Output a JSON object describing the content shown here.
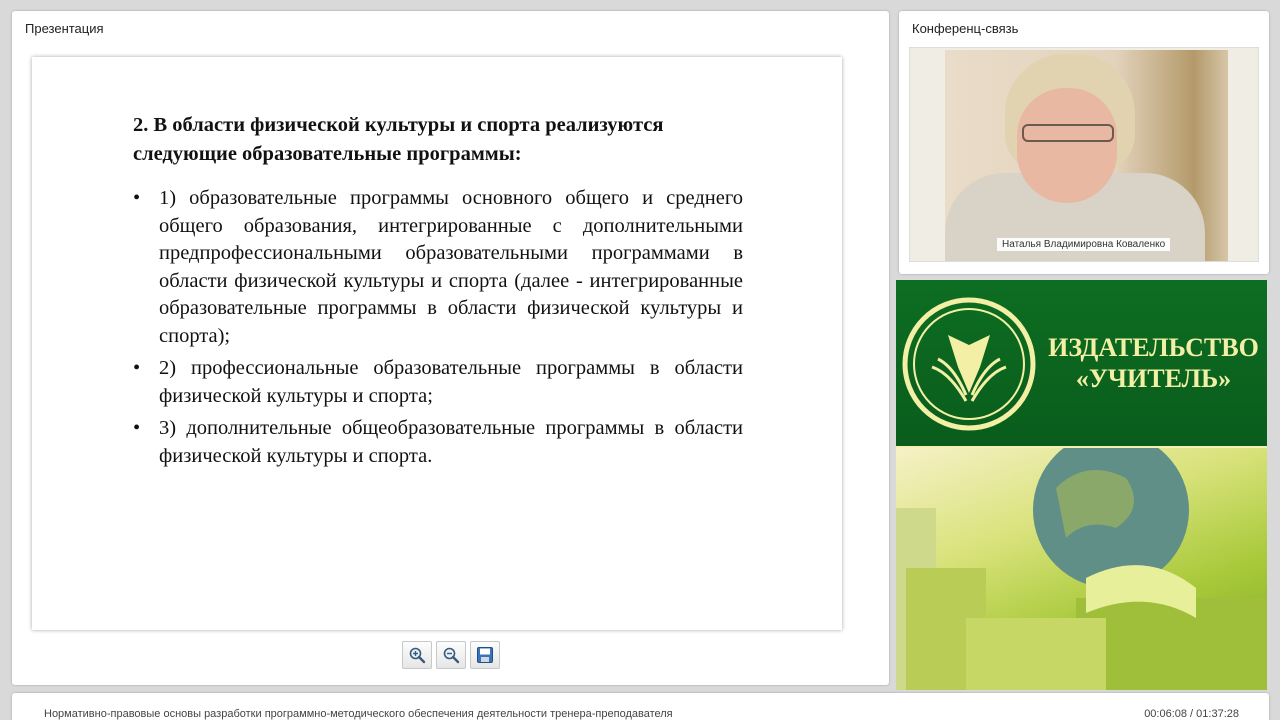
{
  "presentation": {
    "title": "Презентация",
    "slide": {
      "heading": "2. В области физической культуры и спорта реализуются следующие образовательные программы:",
      "items": [
        "1) образовательные программы основного общего и среднего общего образования, интегрированные с дополнительными предпрофессиональными образовательными программами в области физической культуры и спорта (далее - интегрированные образовательные программы в области физической культуры и спорта);",
        "2) профессиональные образовательные программы в области физической культуры и спорта;",
        "3) дополнительные общеобразовательные программы в области физической культуры и спорта."
      ]
    },
    "toolbar": {
      "zoom_in_icon": "zoom-in-icon",
      "zoom_out_icon": "zoom-out-icon",
      "save_icon": "save-icon"
    }
  },
  "conference": {
    "title": "Конференц-связь",
    "speaker_name": "Наталья Владимировна Коваленко"
  },
  "banner": {
    "name_line1": "ИЗДАТЕЛЬСТВО",
    "name_line2": "«УЧИТЕЛЬ»",
    "colors": {
      "green": "#0d6e22",
      "text": "#f3f0a6"
    }
  },
  "footer": {
    "course_title": "Нормативно-правовые основы разработки программно-методического обеспечения деятельности тренера-преподавателя",
    "time": "00:06:08 / 01:37:28"
  }
}
